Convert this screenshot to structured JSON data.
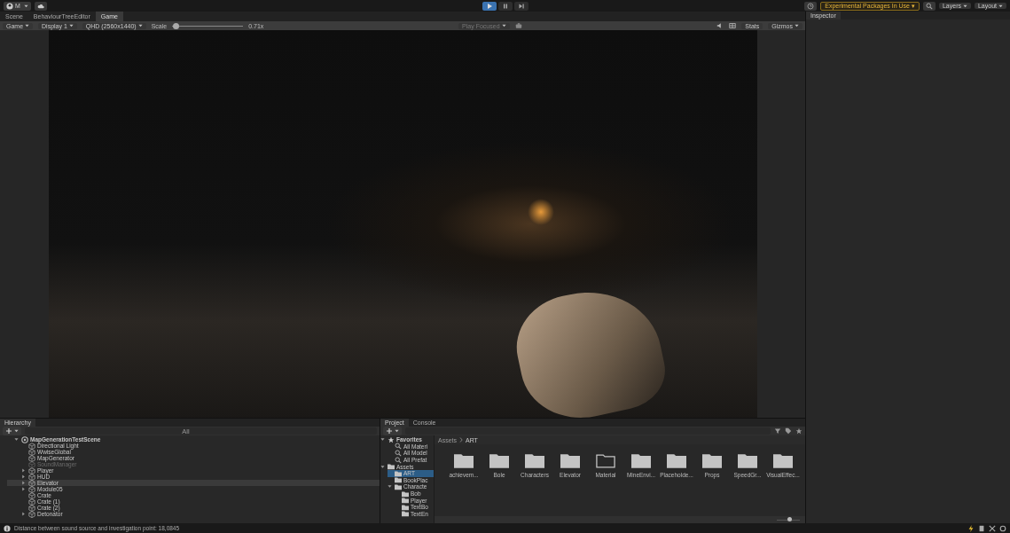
{
  "toolbar": {
    "account": "M",
    "play": {
      "playing": true
    },
    "packages_notice": "Experimental Packages In Use ▾",
    "layers": "Layers",
    "layout": "Layout"
  },
  "editor_tabs": [
    {
      "label": "Scene",
      "selected": false
    },
    {
      "label": "BehaviourTreeEditor",
      "selected": false
    },
    {
      "label": "Game",
      "selected": true
    }
  ],
  "game_toolbar": {
    "view": "Game",
    "display": "Display 1",
    "resolution": "QHD (2560x1440)",
    "scale_label": "Scale",
    "scale": {
      "level": 0.05
    },
    "scale_value": "0.71x",
    "play_mode": "Play Focused",
    "stats": "Stats",
    "gizmos": "Gizmos"
  },
  "inspector": {
    "tab": "Inspector"
  },
  "hierarchy": {
    "tab": "Hierarchy",
    "search": {
      "placeholder": "All"
    },
    "items": [
      {
        "label": "MapGenerationTestScene",
        "kind": "scene",
        "expandable": true,
        "selected": false,
        "disabled": false,
        "children": [
          {
            "label": "Directional Light",
            "kind": "object",
            "expandable": false,
            "selected": false,
            "disabled": false
          },
          {
            "label": "WwiseGlobal",
            "kind": "object",
            "expandable": false,
            "selected": false,
            "disabled": false
          },
          {
            "label": "MapGenerator",
            "kind": "object",
            "expandable": false,
            "selected": false,
            "disabled": false
          },
          {
            "label": "SoundManager",
            "kind": "object",
            "expandable": false,
            "selected": false,
            "disabled": true
          },
          {
            "label": "Player",
            "kind": "object",
            "expandable": true,
            "selected": false,
            "disabled": false
          },
          {
            "label": "HUD",
            "kind": "object",
            "expandable": true,
            "selected": false,
            "disabled": false
          },
          {
            "label": "Elevator",
            "kind": "object",
            "expandable": true,
            "selected": true,
            "disabled": false
          },
          {
            "label": "Module05",
            "kind": "object",
            "expandable": true,
            "selected": false,
            "disabled": false
          },
          {
            "label": "Crate",
            "kind": "object",
            "expandable": false,
            "selected": false,
            "disabled": false
          },
          {
            "label": "Crate (1)",
            "kind": "object",
            "expandable": false,
            "selected": false,
            "disabled": false
          },
          {
            "label": "Crate (2)",
            "kind": "object",
            "expandable": false,
            "selected": false,
            "disabled": false
          },
          {
            "label": "Detonator",
            "kind": "object",
            "expandable": true,
            "selected": false,
            "disabled": false
          }
        ]
      }
    ]
  },
  "project": {
    "tabs": [
      {
        "label": "Project",
        "selected": true
      },
      {
        "label": "Console",
        "selected": false
      }
    ],
    "tree": [
      {
        "label": "Favorites",
        "kind": "favorites",
        "selected": false,
        "children": [
          {
            "label": "All Materi",
            "kind": "search",
            "selected": false
          },
          {
            "label": "All Model",
            "kind": "search",
            "selected": false
          },
          {
            "label": "All Prefat",
            "kind": "search",
            "selected": false
          }
        ]
      },
      {
        "label": "Assets",
        "kind": "folder",
        "selected": false,
        "children": [
          {
            "label": "ART",
            "kind": "folder",
            "selected": true
          },
          {
            "label": "BookPlac",
            "kind": "folder",
            "selected": false
          },
          {
            "label": "Characte",
            "kind": "folder",
            "selected": false,
            "children": [
              {
                "label": "Bob",
                "kind": "folder",
                "selected": false
              },
              {
                "label": "Player",
                "kind": "folder",
                "selected": false
              },
              {
                "label": "TextBo",
                "kind": "folder",
                "selected": false
              },
              {
                "label": "TextEn",
                "kind": "folder",
                "selected": false
              }
            ]
          }
        ]
      }
    ],
    "breadcrumb": [
      "Assets",
      "ART"
    ],
    "icon_size": {
      "level": 0.55
    },
    "folders": [
      {
        "name": "achievem...",
        "empty": false
      },
      {
        "name": "Bole",
        "empty": false
      },
      {
        "name": "Characters",
        "empty": false
      },
      {
        "name": "Elevator",
        "empty": false
      },
      {
        "name": "Material",
        "empty": true
      },
      {
        "name": "MineEnvi...",
        "empty": false
      },
      {
        "name": "Placeholde...",
        "empty": false
      },
      {
        "name": "Props",
        "empty": false
      },
      {
        "name": "SpeedGr...",
        "empty": false
      },
      {
        "name": "VisualEffec...",
        "empty": false
      }
    ]
  },
  "status_bar": {
    "message": "Distance between sound source and investigation point: 18,0845"
  }
}
